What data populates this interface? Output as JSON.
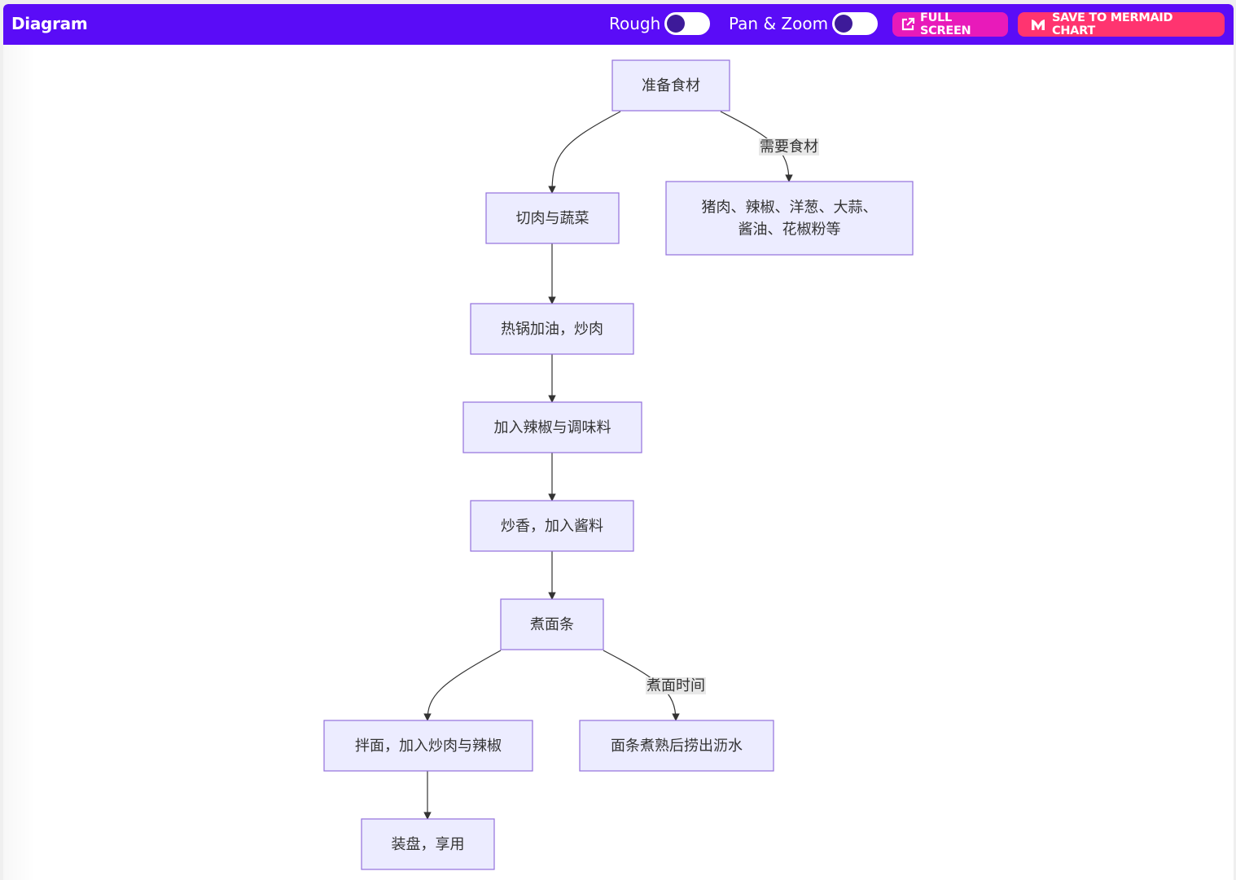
{
  "header": {
    "title": "Diagram",
    "toggles": [
      {
        "label": "Rough",
        "on": false
      },
      {
        "label": "Pan & Zoom",
        "on": false
      }
    ],
    "buttons": {
      "full_screen": "FULL SCREEN",
      "save": "SAVE TO MERMAID CHART"
    },
    "colors": {
      "header_bg": "#5a0cf7",
      "full_screen_bg": "#e81aba",
      "save_bg": "#ff3470",
      "node_fill": "#ececff",
      "node_stroke": "#9370db"
    }
  },
  "diagram": {
    "type": "flowchart",
    "nodes": [
      {
        "id": "A",
        "lines": [
          "准备食材"
        ]
      },
      {
        "id": "B",
        "lines": [
          "切肉与蔬菜"
        ]
      },
      {
        "id": "C",
        "lines": [
          "猪肉、辣椒、洋葱、大蒜、",
          "酱油、花椒粉等"
        ]
      },
      {
        "id": "D",
        "lines": [
          "热锅加油，炒肉"
        ]
      },
      {
        "id": "E",
        "lines": [
          "加入辣椒与调味料"
        ]
      },
      {
        "id": "F",
        "lines": [
          "炒香，加入酱料"
        ]
      },
      {
        "id": "G",
        "lines": [
          "煮面条"
        ]
      },
      {
        "id": "H",
        "lines": [
          "拌面，加入炒肉与辣椒"
        ]
      },
      {
        "id": "I",
        "lines": [
          "面条煮熟后捞出沥水"
        ]
      },
      {
        "id": "J",
        "lines": [
          "装盘，享用"
        ]
      }
    ],
    "edges": [
      {
        "from": "A",
        "to": "B",
        "label": ""
      },
      {
        "from": "A",
        "to": "C",
        "label": "需要食材"
      },
      {
        "from": "B",
        "to": "D",
        "label": ""
      },
      {
        "from": "D",
        "to": "E",
        "label": ""
      },
      {
        "from": "E",
        "to": "F",
        "label": ""
      },
      {
        "from": "F",
        "to": "G",
        "label": ""
      },
      {
        "from": "G",
        "to": "H",
        "label": ""
      },
      {
        "from": "G",
        "to": "I",
        "label": "煮面时间"
      },
      {
        "from": "H",
        "to": "J",
        "label": ""
      }
    ]
  }
}
